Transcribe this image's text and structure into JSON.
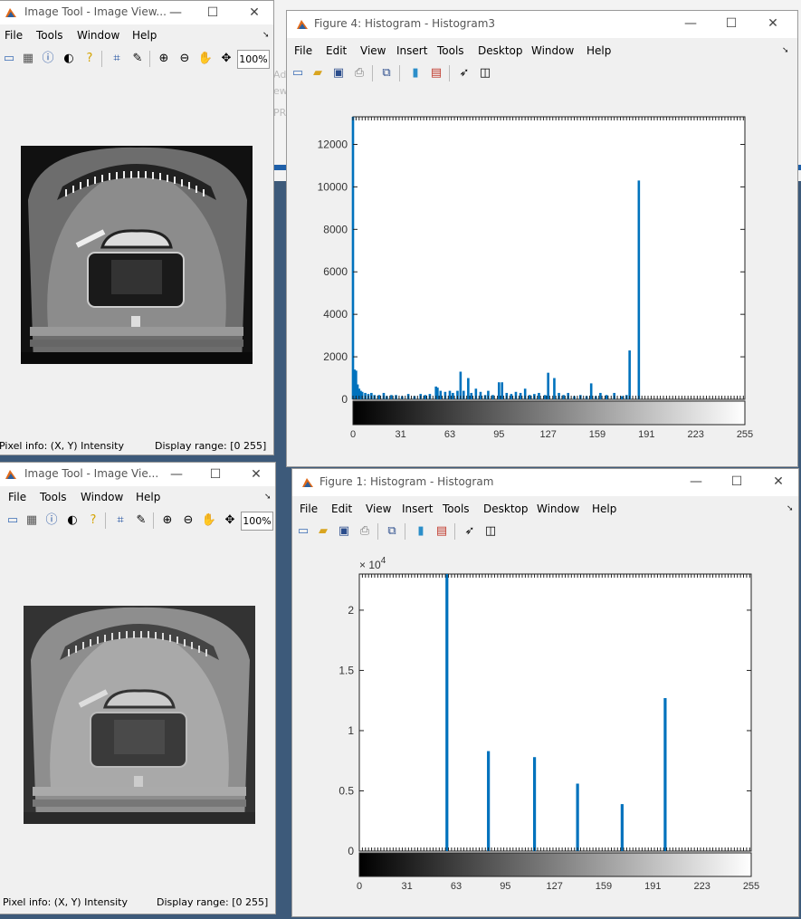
{
  "imtool1": {
    "title": "Image Tool - Image View...",
    "menus": [
      "File",
      "Tools",
      "Window",
      "Help"
    ],
    "zoom": "100%",
    "pixel_info": "Pixel info: (X, Y)  Intensity",
    "display_range": "Display range: [0 255]"
  },
  "imtool2": {
    "title": "Image Tool - Image Vie...",
    "menus": [
      "File",
      "Tools",
      "Window",
      "Help"
    ],
    "zoom": "100%",
    "pixel_info": "Pixel info: (X, Y)  Intensity",
    "display_range": "Display range: [0 255]"
  },
  "fig4": {
    "title": "Figure 4: Histogram - Histogram3",
    "menus": [
      "File",
      "Edit",
      "View",
      "Insert",
      "Tools",
      "Desktop",
      "Window",
      "Help"
    ]
  },
  "fig1": {
    "title": "Figure 1: Histogram - Histogram",
    "menus": [
      "File",
      "Edit",
      "View",
      "Insert",
      "Tools",
      "Desktop",
      "Window",
      "Help"
    ]
  },
  "colors": {
    "bar": "#0072bd"
  },
  "chart_data": [
    {
      "type": "bar",
      "title": "",
      "xlabel": "",
      "ylabel": "",
      "xlim": [
        0,
        255
      ],
      "ylim": [
        0,
        13300
      ],
      "xticks": [
        "0",
        "31",
        "63",
        "95",
        "127",
        "159",
        "191",
        "223",
        "255"
      ],
      "yticks": [
        "0",
        "2000",
        "4000",
        "6000",
        "8000",
        "10000",
        "12000"
      ],
      "x": [
        0,
        1,
        2,
        3,
        4,
        5,
        6,
        8,
        10,
        12,
        14,
        17,
        20,
        22,
        25,
        28,
        32,
        36,
        40,
        44,
        47,
        50,
        54,
        55,
        57,
        60,
        63,
        65,
        68,
        70,
        72,
        75,
        77,
        80,
        83,
        86,
        88,
        91,
        95,
        97,
        100,
        103,
        106,
        109,
        112,
        115,
        118,
        121,
        125,
        127,
        131,
        134,
        137,
        140,
        144,
        148,
        152,
        155,
        158,
        161,
        165,
        170,
        175,
        178,
        180,
        186
      ],
      "values": [
        13500,
        1400,
        1350,
        700,
        500,
        400,
        350,
        300,
        250,
        300,
        200,
        200,
        300,
        150,
        200,
        200,
        150,
        250,
        150,
        250,
        200,
        250,
        600,
        550,
        400,
        350,
        400,
        300,
        400,
        1300,
        400,
        1000,
        300,
        500,
        350,
        200,
        400,
        200,
        800,
        800,
        300,
        250,
        350,
        300,
        500,
        200,
        250,
        300,
        200,
        1250,
        1000,
        300,
        200,
        300,
        150,
        200,
        150,
        750,
        150,
        300,
        200,
        300,
        150,
        200,
        2300,
        10300
      ]
    },
    {
      "type": "bar",
      "title": "",
      "xlabel": "",
      "ylabel": "",
      "exponent": "× 10^4",
      "xlim": [
        0,
        255
      ],
      "ylim": [
        0,
        2.3
      ],
      "xticks": [
        "0",
        "31",
        "63",
        "95",
        "127",
        "159",
        "191",
        "223",
        "255"
      ],
      "yticks": [
        "0",
        "0.5",
        "1",
        "1.5",
        "2"
      ],
      "x": [
        57,
        84,
        114,
        142,
        171,
        199
      ],
      "values": [
        2.3,
        0.83,
        0.78,
        0.56,
        0.39,
        1.27
      ]
    }
  ]
}
